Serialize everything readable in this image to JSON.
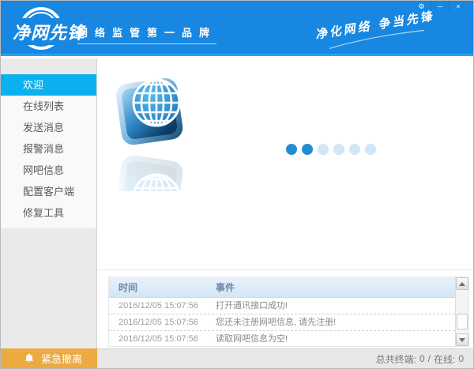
{
  "header": {
    "logo_text": "净网先锋",
    "tagline": "网络监管第一品牌",
    "slogan": "净化网络  争当先锋"
  },
  "window_controls": {
    "settings_icon": "⚙",
    "minimize_icon": "─",
    "close_icon": "×"
  },
  "sidebar": {
    "items": [
      {
        "label": "欢迎",
        "active": true
      },
      {
        "label": "在线列表",
        "active": false
      },
      {
        "label": "发送消息",
        "active": false
      },
      {
        "label": "报警消息",
        "active": false
      },
      {
        "label": "网吧信息",
        "active": false
      },
      {
        "label": "配置客户端",
        "active": false
      },
      {
        "label": "修复工具",
        "active": false
      }
    ]
  },
  "main": {
    "loading_dots": {
      "count": 6,
      "active_count": 2
    }
  },
  "log_table": {
    "columns": [
      "时间",
      "事件"
    ],
    "rows": [
      {
        "time": "2016/12/05 15:07:56",
        "event": "打开通讯接口成功!"
      },
      {
        "time": "2016/12/05 15:07:56",
        "event": "您还未注册网吧信息, 请先注册!"
      },
      {
        "time": "2016/12/05 15:07:56",
        "event": "读取网吧信息为空!"
      }
    ]
  },
  "footer": {
    "emergency_label": "紧急撤离",
    "status": {
      "total_label": "总共终端:",
      "total_value": "0",
      "separator": "/",
      "online_label": "在线:",
      "online_value": "0"
    }
  },
  "colors": {
    "header_blue": "#1787e2",
    "header_strip": "#27a3ef",
    "accent_cyan": "#0bb1ee",
    "emergency_orange": "#ecaa40",
    "dot_active": "#1f8fd2",
    "dot_inactive": "#cfe7f8",
    "table_header_text": "#6d88a6"
  }
}
